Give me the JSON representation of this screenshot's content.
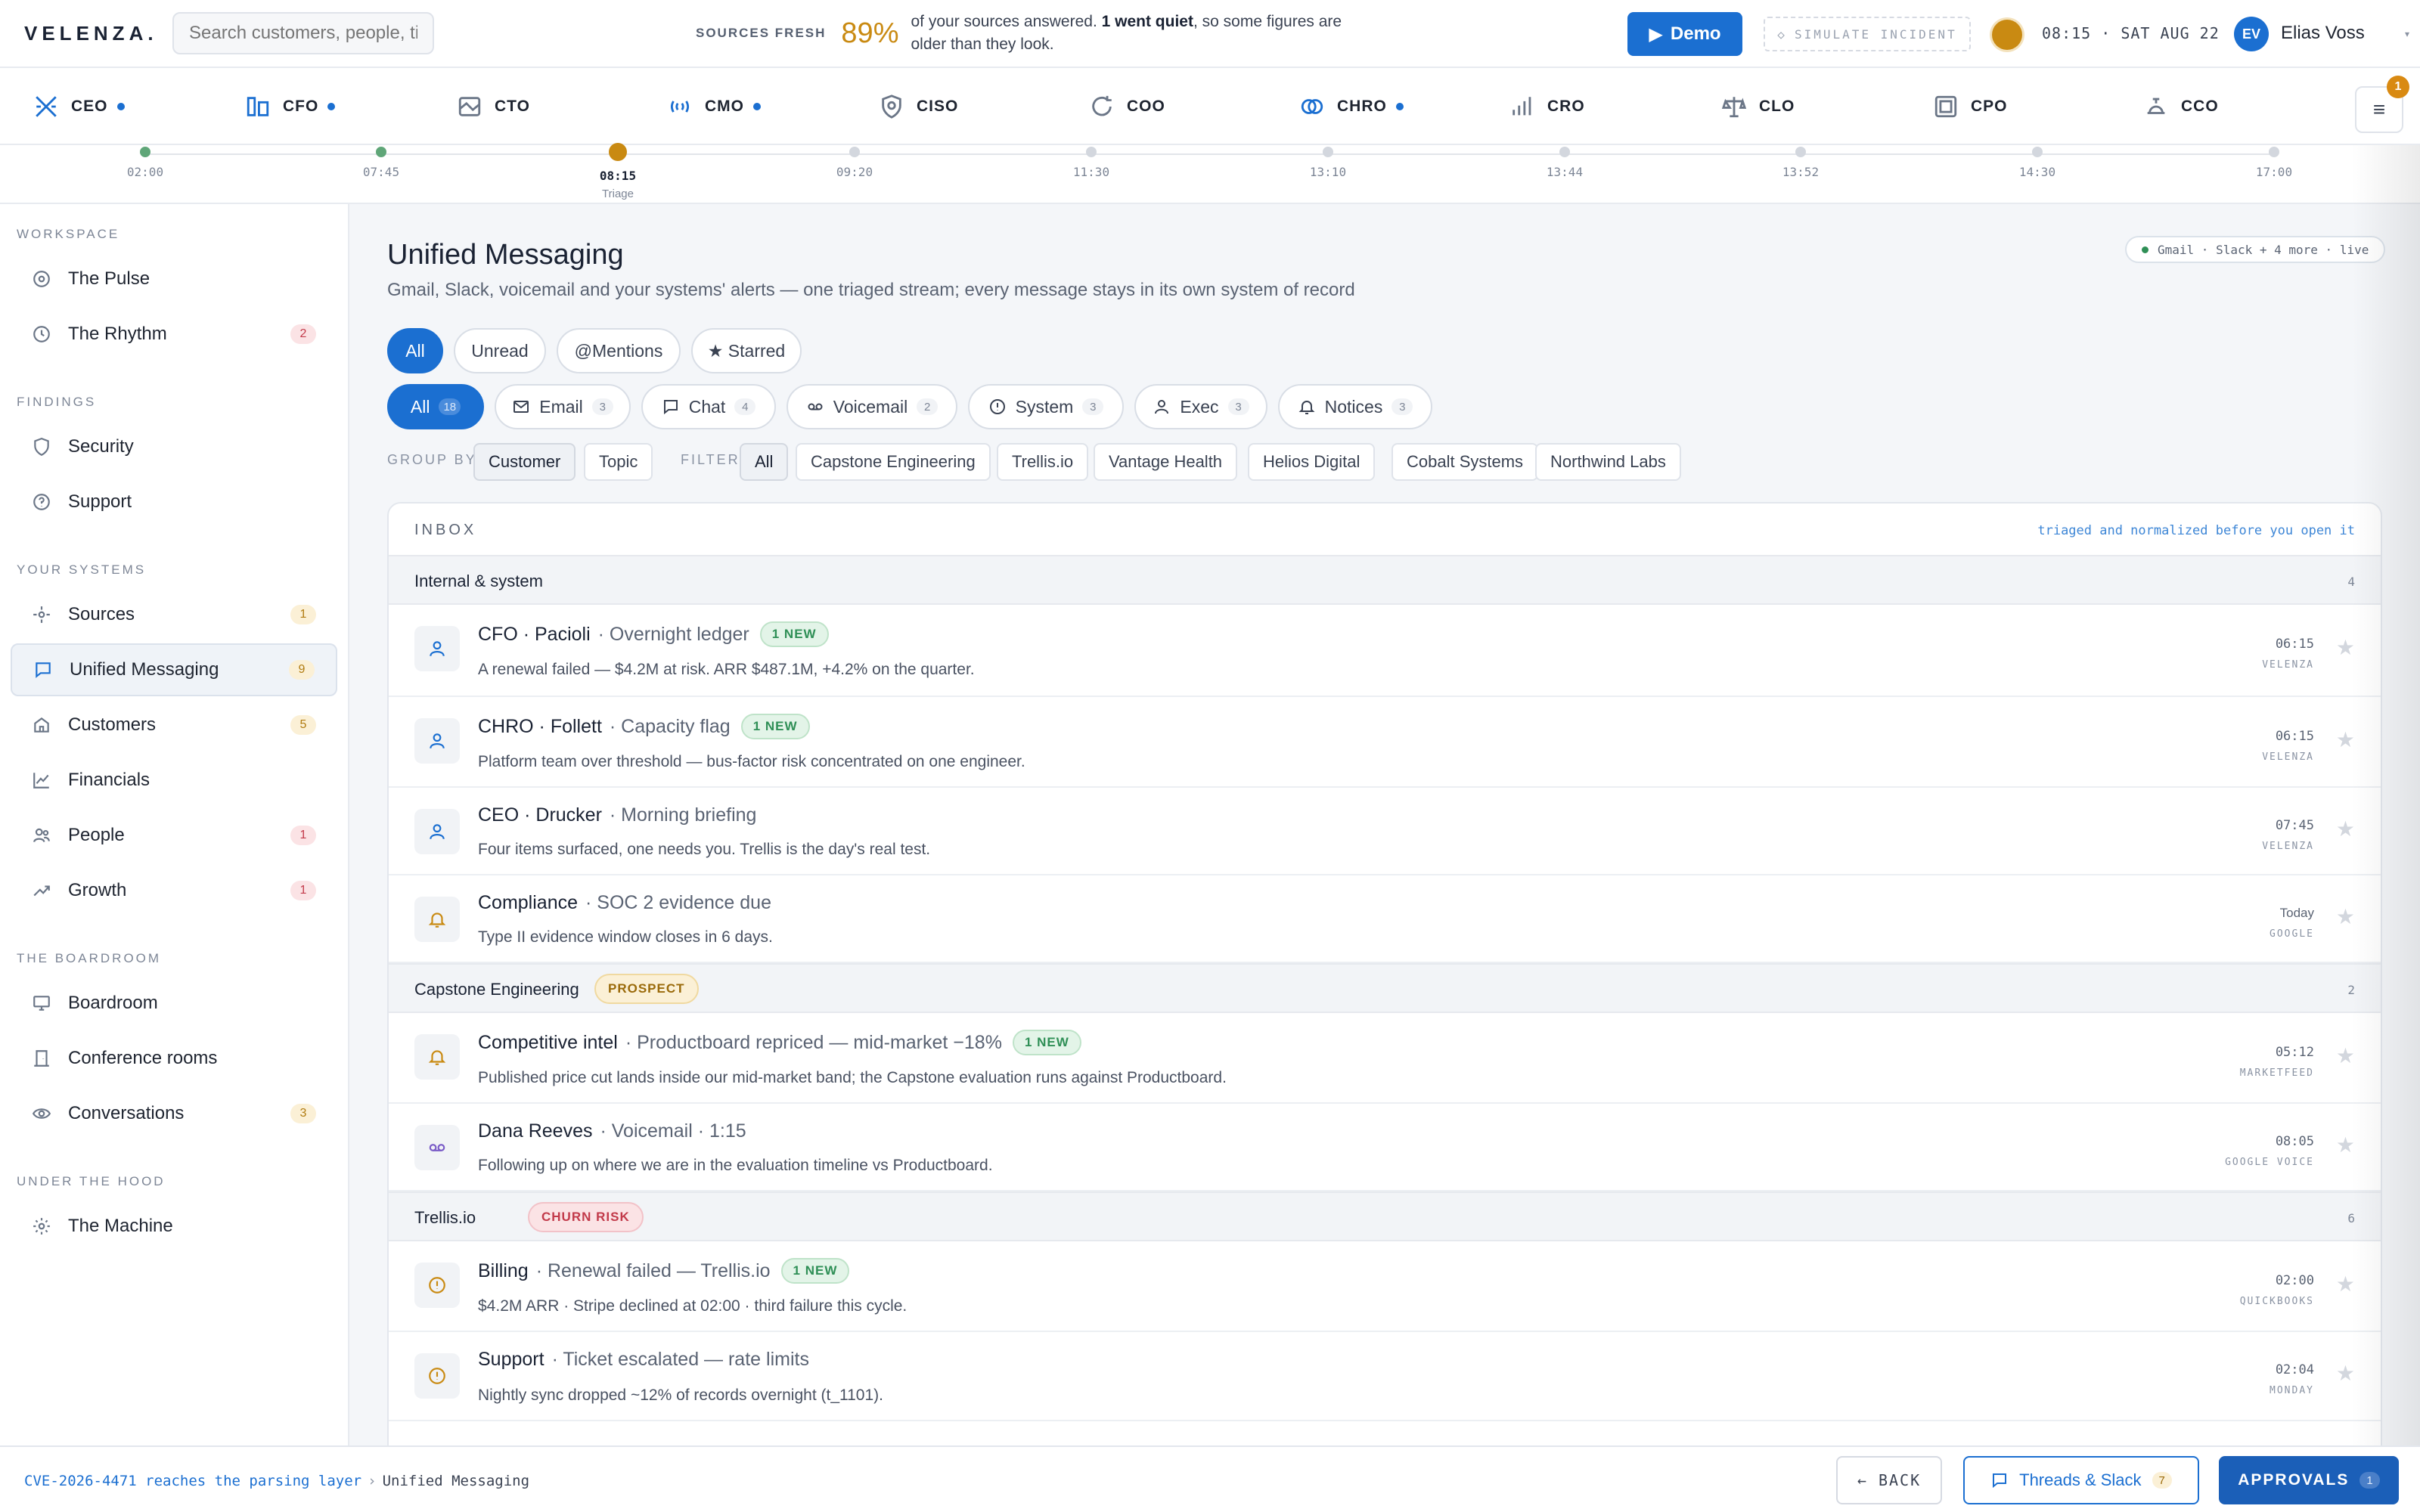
{
  "app": {
    "logo": "VELENZA."
  },
  "search": {
    "placeholder": "Search customers, people, ti"
  },
  "freshness": {
    "label": "SOURCES FRESH",
    "pct": "89%",
    "text_a": "of your sources answered. ",
    "text_bold": "1 went quiet",
    "text_b": ", so some figures are older than they look."
  },
  "header": {
    "demo_label": "Demo",
    "simulate_label": "SIMULATE INCIDENT",
    "clock": "08:15 · SAT AUG 22",
    "user_initials": "EV",
    "user_name": "Elias Voss",
    "menu_badge": "1"
  },
  "roles": [
    {
      "label": "CEO",
      "icon": "ceo-icon",
      "dot": true
    },
    {
      "label": "CFO",
      "icon": "cfo-icon",
      "dot": true
    },
    {
      "label": "CTO",
      "icon": "cto-icon",
      "dot": false
    },
    {
      "label": "CMO",
      "icon": "cmo-icon",
      "dot": true
    },
    {
      "label": "CISO",
      "icon": "shield-icon",
      "dot": false
    },
    {
      "label": "COO",
      "icon": "refresh-icon",
      "dot": false
    },
    {
      "label": "CHRO",
      "icon": "rings-icon",
      "dot": true
    },
    {
      "label": "CRO",
      "icon": "bars-icon",
      "dot": false
    },
    {
      "label": "CLO",
      "icon": "scale-icon",
      "dot": false
    },
    {
      "label": "CPO",
      "icon": "square-icon",
      "dot": false
    },
    {
      "label": "CCO",
      "icon": "bell-desk-icon",
      "dot": false
    }
  ],
  "timeline": [
    {
      "time": "02:00",
      "state": "done"
    },
    {
      "time": "07:45",
      "state": "done"
    },
    {
      "time": "08:15",
      "state": "current",
      "sub": "Triage"
    },
    {
      "time": "09:20",
      "state": "future"
    },
    {
      "time": "11:30",
      "state": "future"
    },
    {
      "time": "13:10",
      "state": "future"
    },
    {
      "time": "13:44",
      "state": "future"
    },
    {
      "time": "13:52",
      "state": "future"
    },
    {
      "time": "14:30",
      "state": "future"
    },
    {
      "time": "17:00",
      "state": "future"
    }
  ],
  "sidebar": {
    "sections": [
      "WORKSPACE",
      "FINDINGS",
      "YOUR SYSTEMS",
      "THE BOARDROOM",
      "UNDER THE HOOD"
    ],
    "items": [
      {
        "label": "The Pulse",
        "count": ""
      },
      {
        "label": "The Rhythm",
        "count": "2"
      },
      {
        "label": "Security",
        "count": ""
      },
      {
        "label": "Support",
        "count": ""
      },
      {
        "label": "Sources",
        "count": "1"
      },
      {
        "label": "Unified Messaging",
        "count": "9"
      },
      {
        "label": "Customers",
        "count": "5"
      },
      {
        "label": "Financials",
        "count": ""
      },
      {
        "label": "People",
        "count": "1"
      },
      {
        "label": "Growth",
        "count": "1"
      },
      {
        "label": "Boardroom",
        "count": ""
      },
      {
        "label": "Conference rooms",
        "count": ""
      },
      {
        "label": "Conversations",
        "count": "3"
      },
      {
        "label": "The Machine",
        "count": ""
      }
    ]
  },
  "main": {
    "title": "Unified Messaging",
    "subtitle": "Gmail, Slack, voicemail and your systems' alerts — one triaged stream; every message stays in its own system of record",
    "live": "Gmail · Slack + 4 more · live",
    "filters1": [
      "All",
      "Unread",
      "@Mentions",
      "★ Starred"
    ],
    "filters2": [
      {
        "label": "All",
        "count": "18"
      },
      {
        "label": "Email",
        "count": "3"
      },
      {
        "label": "Chat",
        "count": "4"
      },
      {
        "label": "Voicemail",
        "count": "2"
      },
      {
        "label": "System",
        "count": "3"
      },
      {
        "label": "Exec",
        "count": "3"
      },
      {
        "label": "Notices",
        "count": "3"
      }
    ],
    "group_by_label": "GROUP BY",
    "group_by": [
      "Customer",
      "Topic"
    ],
    "filter_label": "FILTER",
    "filter_options": [
      "All",
      "Capstone Engineering",
      "Trellis.io",
      "Vantage Health",
      "Helios Digital",
      "Cobalt Systems",
      "Northwind Labs"
    ]
  },
  "inbox": {
    "title": "INBOX",
    "note": "triaged and normalized before you open it",
    "groups": [
      {
        "name": "Internal & system",
        "tag": "",
        "count": "4"
      },
      {
        "name": "Capstone Engineering",
        "tag": "PROSPECT",
        "count": "2"
      },
      {
        "name": "Trellis.io",
        "tag": "CHURN RISK",
        "count": "6"
      }
    ],
    "messages": [
      {
        "sender": "CFO · Pacioli",
        "subject": "· Overnight ledger",
        "badge": "1 NEW",
        "preview": "A renewal failed — $4.2M at risk. ARR $487.1M, +4.2% on the quarter.",
        "time": "06:15",
        "source": "VELENZA",
        "icon": "person-icon"
      },
      {
        "sender": "CHRO · Follett",
        "subject": "· Capacity flag",
        "badge": "1 NEW",
        "preview": "Platform team over threshold — bus-factor risk concentrated on one engineer.",
        "time": "06:15",
        "source": "VELENZA",
        "icon": "person-icon"
      },
      {
        "sender": "CEO · Drucker",
        "subject": "· Morning briefing",
        "badge": "",
        "preview": "Four items surfaced, one needs you. Trellis is the day's real test.",
        "time": "07:45",
        "source": "VELENZA",
        "icon": "person-icon"
      },
      {
        "sender": "Compliance",
        "subject": "· SOC 2 evidence due",
        "badge": "",
        "preview": "Type II evidence window closes in 6 days.",
        "time": "Today",
        "source": "GOOGLE",
        "icon": "bell-icon"
      },
      {
        "sender": "Competitive intel",
        "subject": "· Productboard repriced — mid-market −18%",
        "badge": "1 NEW",
        "preview": "Published price cut lands inside our mid-market band; the Capstone evaluation runs against Productboard.",
        "time": "05:12",
        "source": "MARKETFEED",
        "icon": "bell-icon"
      },
      {
        "sender": "Dana Reeves",
        "subject": "· Voicemail · 1:15",
        "badge": "",
        "preview": "Following up on where we are in the evaluation timeline vs Productboard.",
        "time": "08:05",
        "source": "GOOGLE VOICE",
        "icon": "voicemail-icon"
      },
      {
        "sender": "Billing",
        "subject": "· Renewal failed — Trellis.io",
        "badge": "1 NEW",
        "preview": "$4.2M ARR · Stripe declined at 02:00 · third failure this cycle.",
        "time": "02:00",
        "source": "QUICKBOOKS",
        "icon": "alert-icon"
      },
      {
        "sender": "Support",
        "subject": "· Ticket escalated — rate limits",
        "badge": "",
        "preview": "Nightly sync dropped ~12% of records overnight (t_1101).",
        "time": "02:04",
        "source": "MONDAY",
        "icon": "alert-icon"
      }
    ]
  },
  "footer": {
    "crumb_link": "CVE-2026-4471 reaches the parsing layer",
    "crumb_sep": "›",
    "crumb_current": "Unified Messaging",
    "back_label": "← BACK",
    "threads_label": "Threads & Slack",
    "threads_count": "7",
    "approvals_label": "APPROVALS",
    "approvals_count": "1"
  },
  "colors": {
    "accent": "#1b6fd1",
    "amber": "#c98a12",
    "green": "#2f8f56",
    "red": "#c23a4a"
  }
}
